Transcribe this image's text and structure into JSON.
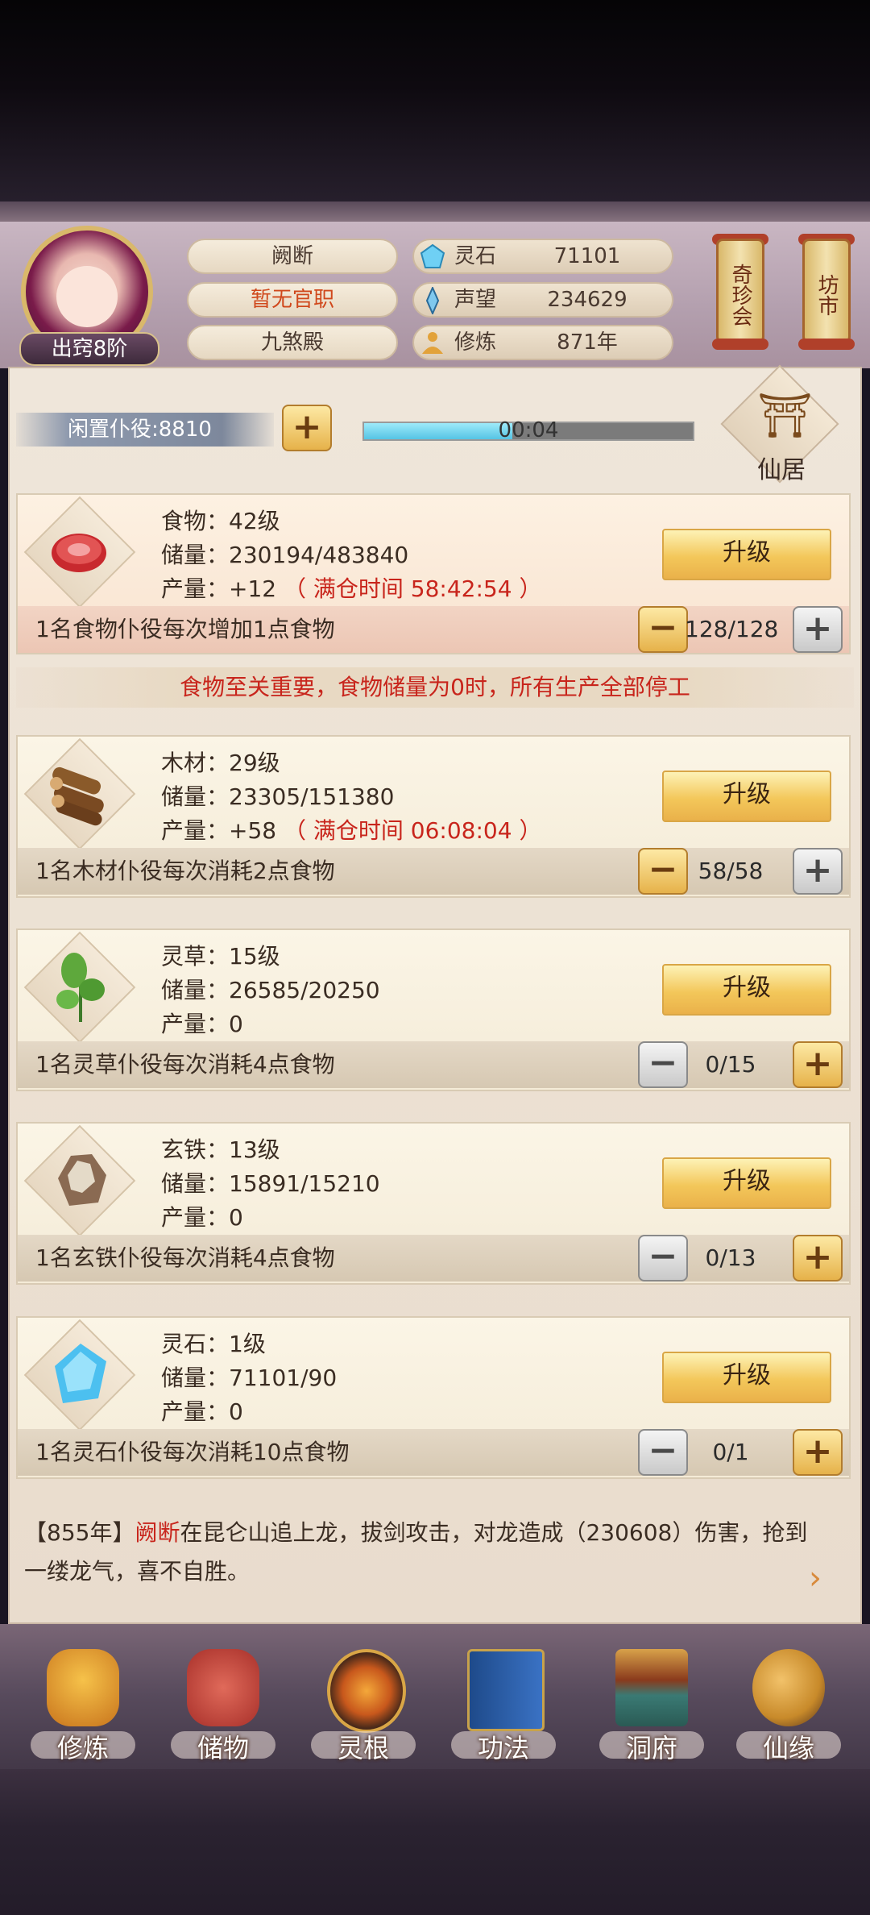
{
  "player": {
    "name": "阙断",
    "office": "暂无官职",
    "sect": "九煞殿",
    "realm": "出窍8阶"
  },
  "resources": {
    "spirit_stone": {
      "label": "灵石",
      "value": "71101"
    },
    "prestige": {
      "label": "声望",
      "value": "234629"
    },
    "cultivation": {
      "label": "修炼",
      "value": "871年"
    }
  },
  "side_buttons": {
    "treasure": "奇珍会",
    "market": "坊市"
  },
  "idle": {
    "label": "闲置仆役:8810",
    "timer": "00:04",
    "progress": 0.45
  },
  "residence": {
    "label": "仙居"
  },
  "upgrade_label": "升级",
  "items": [
    {
      "name": "食物：42级",
      "storage": "储量：230194/483840",
      "output": "产量：+12",
      "full_time": "（ 满仓时间 58:42:54 ）",
      "desc": "1名食物仆役每次增加1点食物",
      "count": "128/128",
      "minus_active": true,
      "plus_active": false
    },
    {
      "name": "木材：29级",
      "storage": "储量：23305/151380",
      "output": "产量：+58",
      "full_time": "（ 满仓时间 06:08:04 ）",
      "desc": "1名木材仆役每次消耗2点食物",
      "count": "58/58",
      "minus_active": true,
      "plus_active": false
    },
    {
      "name": "灵草：15级",
      "storage": "储量：26585/20250",
      "output": "产量：0",
      "full_time": "",
      "desc": "1名灵草仆役每次消耗4点食物",
      "count": "0/15",
      "minus_active": false,
      "plus_active": true
    },
    {
      "name": "玄铁：13级",
      "storage": "储量：15891/15210",
      "output": "产量：0",
      "full_time": "",
      "desc": "1名玄铁仆役每次消耗4点食物",
      "count": "0/13",
      "minus_active": false,
      "plus_active": true
    },
    {
      "name": "灵石：1级",
      "storage": "储量：71101/90",
      "output": "产量：0",
      "full_time": "",
      "desc": "1名灵石仆役每次消耗10点食物",
      "count": "0/1",
      "minus_active": false,
      "plus_active": true
    }
  ],
  "warning": "食物至关重要，食物储量为0时，所有生产全部停工",
  "log": {
    "year": "【855年】",
    "name": "阙断",
    "text": "在昆仑山追上龙，拔剑攻击，对龙造成（230608）伤害，抢到一缕龙气，喜不自胜。"
  },
  "nav": [
    "修炼",
    "储物",
    "灵根",
    "功法",
    "洞府",
    "仙缘"
  ]
}
